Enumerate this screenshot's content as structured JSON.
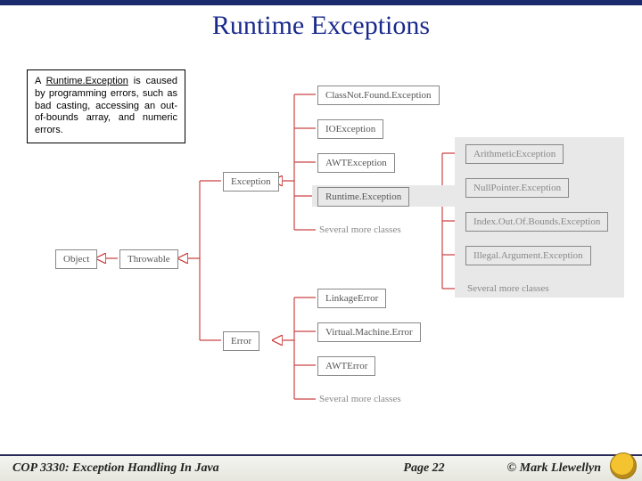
{
  "title": "Runtime Exceptions",
  "callout": {
    "prefix": "A ",
    "term": "Runtime.Exception",
    "rest": " is caused by programming errors, such as bad casting, accessing an out-of-bounds array, and numeric errors."
  },
  "nodes": {
    "object": "Object",
    "throwable": "Throwable",
    "exception": "Exception",
    "error": "Error",
    "classNotFound": "ClassNot.Found.Exception",
    "ioException": "IOException",
    "awtException": "AWTException",
    "runtimeException": "Runtime.Exception",
    "linkageError": "LinkageError",
    "vmError": "Virtual.Machine.Error",
    "awtError": "AWTError",
    "arithmetic": "ArithmeticException",
    "nullPointer": "NullPointer.Exception",
    "indexOOB": "Index.Out.Of.Bounds.Exception",
    "illegalArg": "Illegal.Argument.Exception"
  },
  "more": "Several more classes",
  "footer": {
    "course": "COP 3330:  Exception Handling In Java",
    "page": "Page 22",
    "copyright": "© Mark Llewellyn"
  }
}
